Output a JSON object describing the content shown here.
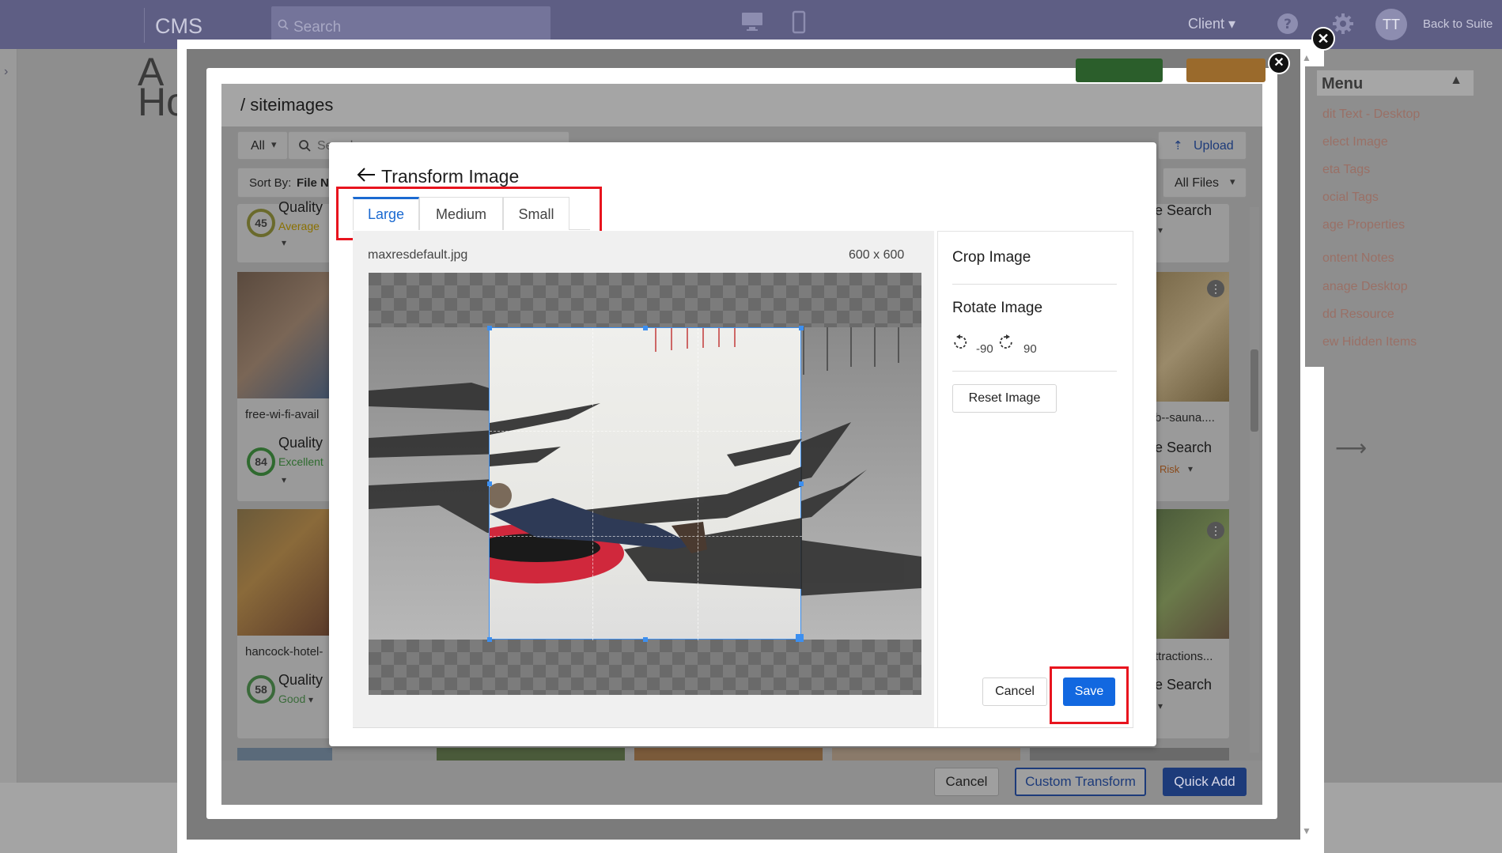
{
  "topbar": {
    "app_name": "CMS",
    "search_placeholder": "Search",
    "client_label": "Client",
    "avatar_initials": "TT",
    "back_label": "Back to Suite"
  },
  "background": {
    "heading_fragment_1": "A",
    "heading_fragment_2": "Ho"
  },
  "menu": {
    "title": "Menu",
    "items": [
      "dit Text - Desktop",
      "elect Image",
      "eta Tags",
      "ocial Tags",
      "age Properties",
      "ontent Notes",
      "anage Desktop",
      "dd Resource",
      "ew Hidden Items"
    ]
  },
  "site_images": {
    "title": "/ siteimages",
    "filter_label": "All",
    "search_placeholder": "Search",
    "upload_label": "Upload",
    "sort_label": "Sort By:",
    "sort_value": "File N",
    "all_files_label": "All Files",
    "cards_left": [
      {
        "name": "",
        "quality_score": "45",
        "quality_label": "Quality",
        "quality_rating": "Average"
      },
      {
        "name": "free-wi-fi-avail",
        "quality_score": "84",
        "quality_label": "Quality",
        "quality_rating": "Excellent"
      },
      {
        "name": "hancock-hotel-",
        "quality_score": "58",
        "quality_label": "Quality",
        "quality_rating": "Good"
      }
    ],
    "cards_right": [
      {
        "name": "",
        "label": "e Search"
      },
      {
        "name": "b--sauna....",
        "label": "e Search",
        "rating": "Risk"
      },
      {
        "name": "ttractions...",
        "label": "e Search"
      }
    ],
    "buttons": {
      "cancel": "Cancel",
      "custom_transform": "Custom Transform",
      "quick_add": "Quick Add"
    }
  },
  "transform": {
    "title": "Transform Image",
    "tabs": [
      "Large",
      "Medium",
      "Small"
    ],
    "active_tab": "Large",
    "file_name": "maxresdefault.jpg",
    "dimensions": "600 x 600",
    "crop_label": "Crop Image",
    "rotate_label": "Rotate Image",
    "rotate_left_value": "-90",
    "rotate_right_value": "90",
    "reset_label": "Reset Image",
    "cancel_label": "Cancel",
    "save_label": "Save"
  },
  "colors": {
    "accent": "#1268e0",
    "highlight": "#e8141e"
  }
}
